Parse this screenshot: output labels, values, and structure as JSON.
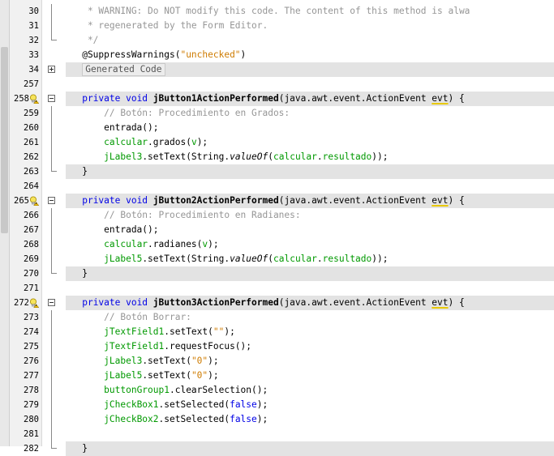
{
  "editor": {
    "lines": [
      {
        "n": "30",
        "segs": [
          {
            "t": "    * WARNING: Do NOT modify this code. The content of this method is alwa",
            "c": "cm"
          }
        ],
        "fold": "line"
      },
      {
        "n": "31",
        "segs": [
          {
            "t": "    * regenerated by the Form Editor.",
            "c": "cm"
          }
        ],
        "fold": "line"
      },
      {
        "n": "32",
        "segs": [
          {
            "t": "    */",
            "c": "cm"
          }
        ],
        "fold": "end"
      },
      {
        "n": "33",
        "segs": [
          {
            "t": "   @SuppressWarnings(",
            "c": "ann"
          },
          {
            "t": "\"unchecked\"",
            "c": "str"
          },
          {
            "t": ")",
            "c": ""
          }
        ]
      },
      {
        "n": "34",
        "hl": true,
        "fold": "plus",
        "gen": "Generated Code"
      },
      {
        "n": "257",
        "segs": []
      },
      {
        "n": "258",
        "hl": true,
        "bulb": true,
        "fold": "minus",
        "segs": [
          {
            "t": "   ",
            "c": ""
          },
          {
            "t": "private void ",
            "c": "kw"
          },
          {
            "t": "jButton1ActionPerformed",
            "c": "mn"
          },
          {
            "t": "(java.awt.event.ActionEvent ",
            "c": ""
          },
          {
            "t": "evt",
            "c": "ul"
          },
          {
            "t": ") {",
            "c": ""
          }
        ]
      },
      {
        "n": "259",
        "fold": "line",
        "segs": [
          {
            "t": "       // Botón: Procedimiento en Grados:",
            "c": "cm"
          }
        ]
      },
      {
        "n": "260",
        "fold": "line",
        "segs": [
          {
            "t": "       entrada();",
            "c": ""
          }
        ]
      },
      {
        "n": "261",
        "fold": "line",
        "segs": [
          {
            "t": "       ",
            "c": ""
          },
          {
            "t": "calcular",
            "c": "fld"
          },
          {
            "t": ".grados(",
            "c": ""
          },
          {
            "t": "v",
            "c": "fld"
          },
          {
            "t": ");",
            "c": ""
          }
        ]
      },
      {
        "n": "262",
        "fold": "line",
        "segs": [
          {
            "t": "       ",
            "c": ""
          },
          {
            "t": "jLabel3",
            "c": "fld"
          },
          {
            "t": ".setText(String.",
            "c": ""
          },
          {
            "t": "valueOf",
            "c": "it"
          },
          {
            "t": "(",
            "c": ""
          },
          {
            "t": "calcular",
            "c": "fld"
          },
          {
            "t": ".",
            "c": ""
          },
          {
            "t": "resultado",
            "c": "fld"
          },
          {
            "t": "));",
            "c": ""
          }
        ]
      },
      {
        "n": "263",
        "hl": true,
        "fold": "end",
        "segs": [
          {
            "t": "   }",
            "c": ""
          }
        ]
      },
      {
        "n": "264",
        "segs": []
      },
      {
        "n": "265",
        "hl": true,
        "bulb": true,
        "fold": "minus",
        "segs": [
          {
            "t": "   ",
            "c": ""
          },
          {
            "t": "private void ",
            "c": "kw"
          },
          {
            "t": "jButton2ActionPerformed",
            "c": "mn"
          },
          {
            "t": "(java.awt.event.ActionEvent ",
            "c": ""
          },
          {
            "t": "evt",
            "c": "ul"
          },
          {
            "t": ") {",
            "c": ""
          }
        ]
      },
      {
        "n": "266",
        "fold": "line",
        "segs": [
          {
            "t": "       // Botón: Procedimiento en Radianes:",
            "c": "cm"
          }
        ]
      },
      {
        "n": "267",
        "fold": "line",
        "segs": [
          {
            "t": "       entrada();",
            "c": ""
          }
        ]
      },
      {
        "n": "268",
        "fold": "line",
        "segs": [
          {
            "t": "       ",
            "c": ""
          },
          {
            "t": "calcular",
            "c": "fld"
          },
          {
            "t": ".radianes(",
            "c": ""
          },
          {
            "t": "v",
            "c": "fld"
          },
          {
            "t": ");",
            "c": ""
          }
        ]
      },
      {
        "n": "269",
        "fold": "line",
        "segs": [
          {
            "t": "       ",
            "c": ""
          },
          {
            "t": "jLabel5",
            "c": "fld"
          },
          {
            "t": ".setText(String.",
            "c": ""
          },
          {
            "t": "valueOf",
            "c": "it"
          },
          {
            "t": "(",
            "c": ""
          },
          {
            "t": "calcular",
            "c": "fld"
          },
          {
            "t": ".",
            "c": ""
          },
          {
            "t": "resultado",
            "c": "fld"
          },
          {
            "t": "));",
            "c": ""
          }
        ]
      },
      {
        "n": "270",
        "hl": true,
        "fold": "end",
        "segs": [
          {
            "t": "   }",
            "c": ""
          }
        ]
      },
      {
        "n": "271",
        "segs": []
      },
      {
        "n": "272",
        "hl": true,
        "bulb": true,
        "fold": "minus",
        "segs": [
          {
            "t": "   ",
            "c": ""
          },
          {
            "t": "private void ",
            "c": "kw"
          },
          {
            "t": "jButton3ActionPerformed",
            "c": "mn"
          },
          {
            "t": "(java.awt.event.ActionEvent ",
            "c": ""
          },
          {
            "t": "evt",
            "c": "ul"
          },
          {
            "t": ") {",
            "c": ""
          }
        ]
      },
      {
        "n": "273",
        "fold": "line",
        "segs": [
          {
            "t": "       // Botón Borrar:",
            "c": "cm"
          }
        ]
      },
      {
        "n": "274",
        "fold": "line",
        "segs": [
          {
            "t": "       ",
            "c": ""
          },
          {
            "t": "jTextField1",
            "c": "fld"
          },
          {
            "t": ".setText(",
            "c": ""
          },
          {
            "t": "\"\"",
            "c": "str"
          },
          {
            "t": ");",
            "c": ""
          }
        ]
      },
      {
        "n": "275",
        "fold": "line",
        "segs": [
          {
            "t": "       ",
            "c": ""
          },
          {
            "t": "jTextField1",
            "c": "fld"
          },
          {
            "t": ".requestFocus();",
            "c": ""
          }
        ]
      },
      {
        "n": "276",
        "fold": "line",
        "segs": [
          {
            "t": "       ",
            "c": ""
          },
          {
            "t": "jLabel3",
            "c": "fld"
          },
          {
            "t": ".setText(",
            "c": ""
          },
          {
            "t": "\"0\"",
            "c": "str"
          },
          {
            "t": ");",
            "c": ""
          }
        ]
      },
      {
        "n": "277",
        "fold": "line",
        "segs": [
          {
            "t": "       ",
            "c": ""
          },
          {
            "t": "jLabel5",
            "c": "fld"
          },
          {
            "t": ".setText(",
            "c": ""
          },
          {
            "t": "\"0\"",
            "c": "str"
          },
          {
            "t": ");",
            "c": ""
          }
        ]
      },
      {
        "n": "278",
        "fold": "line",
        "segs": [
          {
            "t": "       ",
            "c": ""
          },
          {
            "t": "buttonGroup1",
            "c": "fld"
          },
          {
            "t": ".clearSelection();",
            "c": ""
          }
        ]
      },
      {
        "n": "279",
        "fold": "line",
        "segs": [
          {
            "t": "       ",
            "c": ""
          },
          {
            "t": "jCheckBox1",
            "c": "fld"
          },
          {
            "t": ".setSelected(",
            "c": ""
          },
          {
            "t": "false",
            "c": "kw"
          },
          {
            "t": ");",
            "c": ""
          }
        ]
      },
      {
        "n": "280",
        "fold": "line",
        "segs": [
          {
            "t": "       ",
            "c": ""
          },
          {
            "t": "jCheckBox2",
            "c": "fld"
          },
          {
            "t": ".setSelected(",
            "c": ""
          },
          {
            "t": "false",
            "c": "kw"
          },
          {
            "t": ");",
            "c": ""
          }
        ]
      },
      {
        "n": "281",
        "fold": "line",
        "segs": []
      },
      {
        "n": "282",
        "hl": true,
        "fold": "end",
        "segs": [
          {
            "t": "   }",
            "c": ""
          }
        ]
      }
    ]
  },
  "colors": {
    "keyword": "#0000e6",
    "comment": "#969696",
    "field": "#009900",
    "string": "#ce7b00",
    "highlight_line": "#e3e3e3"
  },
  "icons": {
    "hint": "lightbulb-warning-icon",
    "fold_expand": "plus-box-icon",
    "fold_collapse": "minus-box-icon"
  }
}
